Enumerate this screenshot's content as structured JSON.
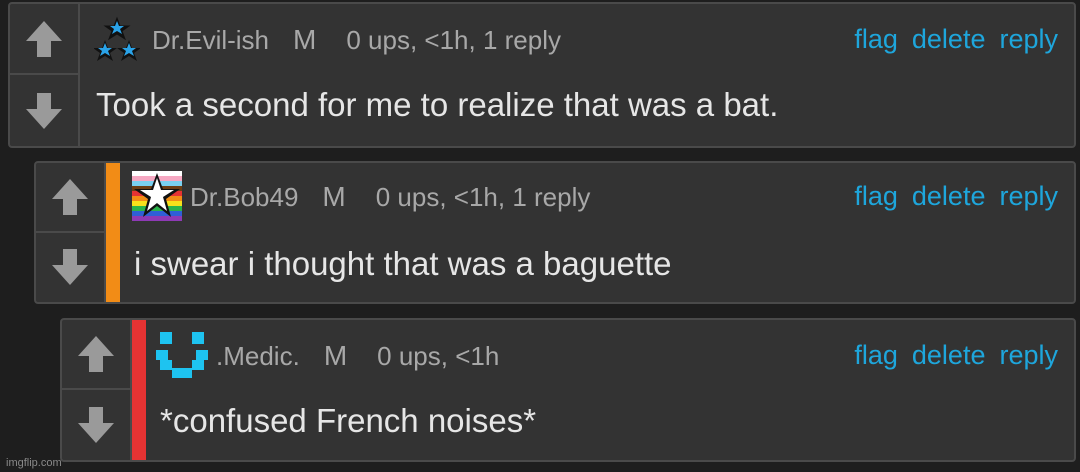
{
  "colors": {
    "link": "#1ea6dc",
    "bar_level2": "#f28c16",
    "bar_level3": "#e53333"
  },
  "comments": [
    {
      "username": "Dr.Evil-ish",
      "mark": "M",
      "stats": "0 ups, <1h, 1 reply",
      "body": "Took a second for me to realize that was a bat.",
      "actions": [
        "flag",
        "delete",
        "reply"
      ],
      "avatar_icon": "blue-stars-icon"
    },
    {
      "username": "Dr.Bob49",
      "mark": "M",
      "stats": "0 ups, <1h, 1 reply",
      "body": "i swear i thought that was a baguette",
      "actions": [
        "flag",
        "delete",
        "reply"
      ],
      "avatar_icon": "rainbow-star-icon"
    },
    {
      "username": ".Medic.",
      "mark": "M",
      "stats": "0 ups, <1h",
      "body": "*confused French noises*",
      "actions": [
        "flag",
        "delete",
        "reply"
      ],
      "avatar_icon": "pixel-smiley-icon"
    }
  ],
  "watermark": "imgflip.com"
}
